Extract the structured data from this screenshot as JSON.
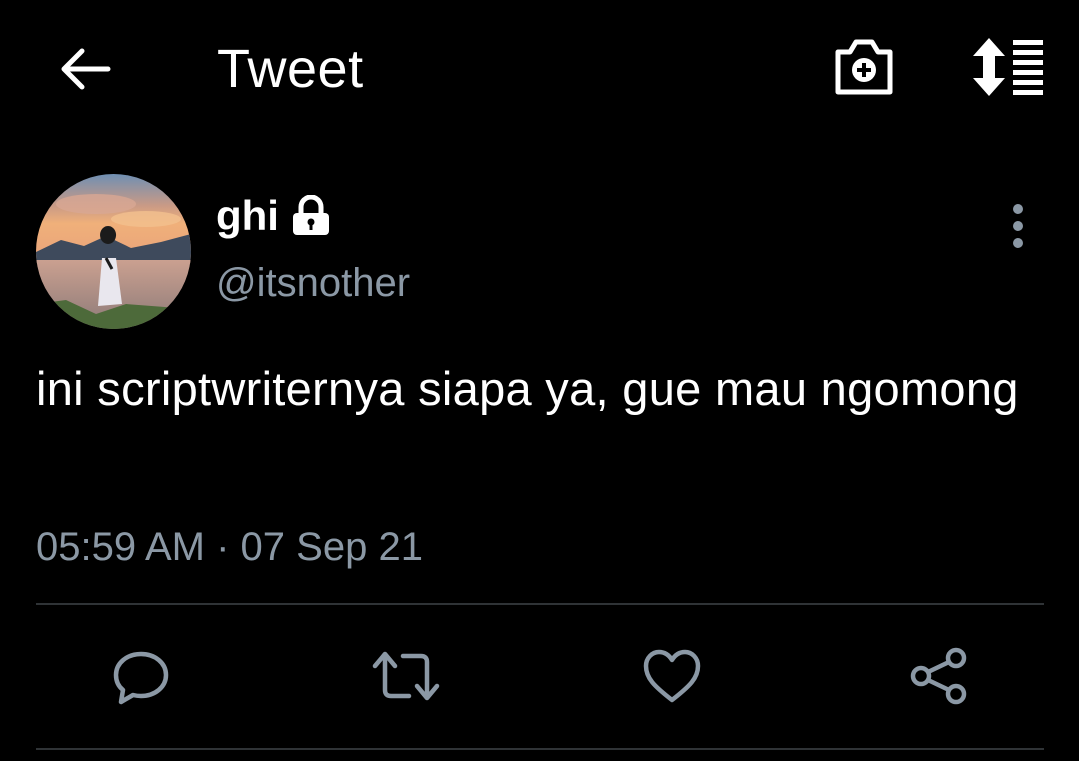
{
  "header": {
    "title": "Tweet",
    "icons": [
      "back-arrow-icon",
      "camera-plus-icon",
      "sort-list-icon"
    ]
  },
  "tweet": {
    "display_name": "ghi",
    "handle": "@itsnother",
    "protected_icon": "lock-icon",
    "text": "ini scriptwriternya siapa ya, gue mau ngomong",
    "timestamp": "05:59 AM · 07 Sep 21"
  },
  "actions": [
    "reply-icon",
    "retweet-icon",
    "like-icon",
    "share-icon"
  ],
  "colors": {
    "background": "#000000",
    "text": "#ffffff",
    "secondary": "#8b98a5",
    "divider": "#2f3336"
  }
}
